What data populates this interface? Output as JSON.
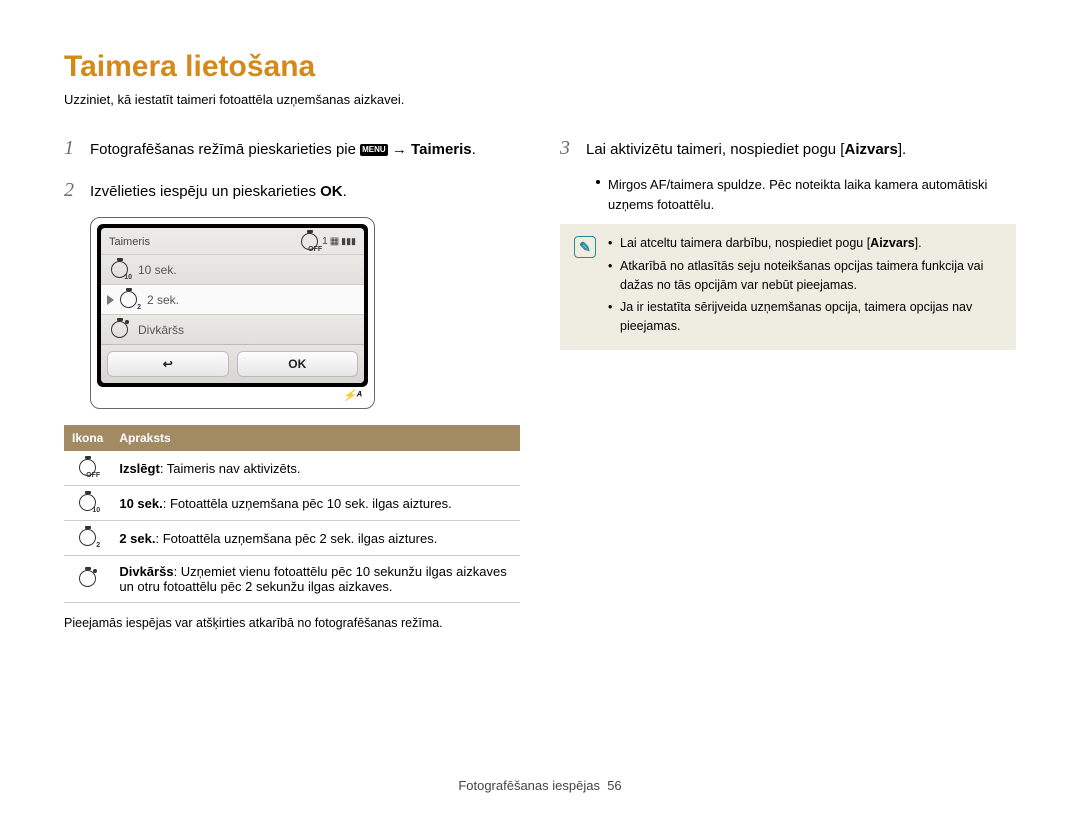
{
  "title": "Taimera lietošana",
  "subtitle": "Uzziniet, kā iestatīt taimeri fotoattēla uzņemšanas aizkavei.",
  "steps": {
    "s1_prefix": "Fotografēšanas režīmā pieskarieties pie ",
    "s1_menu": "MENU",
    "s1_arrow": " → ",
    "s1_target": "Taimeris",
    "s2_prefix": "Izvēlieties iespēju un pieskarieties ",
    "s2_ok": "OK",
    "s3_prefix": "Lai aktivizētu taimeri, nospiediet pogu [",
    "s3_bold": "Aizvars",
    "s3_suffix": "].",
    "s3_sub": "Mirgos AF/taimera spuldze. Pēc noteikta laika kamera automātiski uzņems fotoattēlu."
  },
  "device": {
    "title": "Taimeris",
    "counter": "1",
    "items": [
      "10 sek.",
      "2 sek.",
      "Divkāršs"
    ],
    "back": "↩",
    "ok": "OK",
    "flash": "⚡ᴬ"
  },
  "table": {
    "h1": "Ikona",
    "h2": "Apraksts",
    "rows": [
      {
        "icon_sub": "OFF",
        "bold": "Izslēgt",
        "text": ": Taimeris nav aktivizēts."
      },
      {
        "icon_sub": "10",
        "bold": "10 sek.",
        "text": ": Fotoattēla uzņemšana pēc 10 sek. ilgas aiztures."
      },
      {
        "icon_sub": "2",
        "bold": "2 sek.",
        "text": ": Fotoattēla uzņemšana pēc 2 sek. ilgas aiztures."
      },
      {
        "icon_dot": true,
        "bold": "Divkāršs",
        "text": ": Uzņemiet vienu fotoattēlu pēc 10 sekunžu ilgas aizkaves un otru fotoattēlu pēc 2 sekunžu ilgas aizkaves."
      }
    ]
  },
  "footnote": "Pieejamās iespējas var atšķirties atkarībā no fotografēšanas režīma.",
  "notes": [
    {
      "prefix": "Lai atceltu taimera darbību, nospiediet pogu [",
      "bold": "Aizvars",
      "suffix": "]."
    },
    {
      "text": "Atkarībā no atlasītās seju noteikšanas opcijas taimera funkcija vai dažas no tās opcijām var nebūt pieejamas."
    },
    {
      "text": "Ja ir iestatīta sērijveida uzņemšanas opcija, taimera opcijas nav pieejamas."
    }
  ],
  "footer": {
    "section": "Fotografēšanas iespējas",
    "page": "56"
  }
}
